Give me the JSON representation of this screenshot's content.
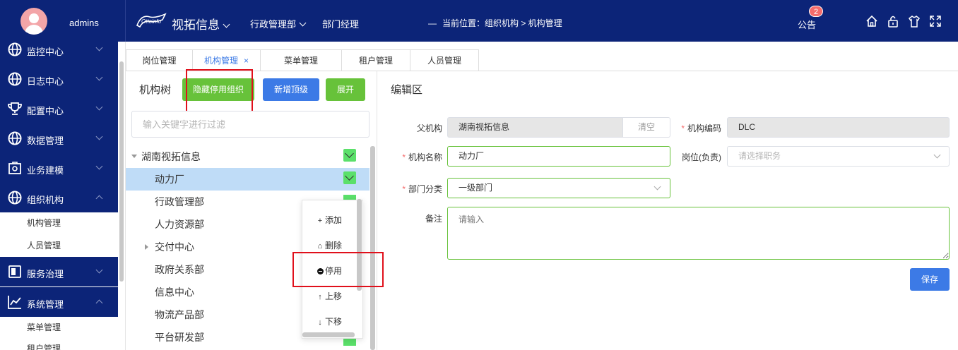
{
  "header": {
    "username": "admins",
    "brand": "视拓信息",
    "nav": [
      "行政管理部",
      "部门经理"
    ],
    "breadcrumb": "当前位置：组织机构 > 机构管理",
    "notice_label": "公告",
    "notice_count": "2"
  },
  "sidebar": {
    "items": [
      {
        "label": "监控中心",
        "icon": "globe-icon",
        "expanded": false
      },
      {
        "label": "日志中心",
        "icon": "globe-icon",
        "expanded": false
      },
      {
        "label": "配置中心",
        "icon": "trophy-icon",
        "expanded": false
      },
      {
        "label": "数据管理",
        "icon": "globe-icon",
        "expanded": false
      },
      {
        "label": "业务建模",
        "icon": "briefcase-gear-icon",
        "expanded": false
      },
      {
        "label": "组织机构",
        "icon": "globe-icon",
        "expanded": true,
        "children": [
          "机构管理",
          "人员管理"
        ]
      },
      {
        "label": "服务治理",
        "icon": "book-icon",
        "expanded": false
      },
      {
        "label": "系统管理",
        "icon": "chart-icon",
        "expanded": true,
        "children": [
          "菜单管理",
          "租户管理"
        ]
      }
    ]
  },
  "tabs": [
    {
      "label": "岗位管理",
      "active": false
    },
    {
      "label": "机构管理",
      "active": true,
      "close": "×"
    },
    {
      "label": "菜单管理",
      "active": false
    },
    {
      "label": "租户管理",
      "active": false
    },
    {
      "label": "人员管理",
      "active": false
    }
  ],
  "tree": {
    "title": "机构树",
    "buttons": {
      "hide_disabled": "隐藏停用组织",
      "add_top": "新增顶级",
      "expand": "展开"
    },
    "filter_placeholder": "输入关键字进行过滤",
    "nodes": [
      "湖南视拓信息",
      "动力厂",
      "行政管理部",
      "人力资源部",
      "交付中心",
      "政府关系部",
      "信息中心",
      "物流产品部",
      "平台研发部"
    ]
  },
  "context_menu": [
    {
      "label": "添加",
      "icon": "plus-icon"
    },
    {
      "label": "删除",
      "icon": "trash-icon"
    },
    {
      "label": "停用",
      "icon": "minus-circle-icon"
    },
    {
      "label": "上移",
      "icon": "arrow-up-icon"
    },
    {
      "label": "下移",
      "icon": "arrow-down-icon"
    }
  ],
  "editor": {
    "title": "编辑区",
    "parent_label": "父机构",
    "parent_value": "湖南视拓信息",
    "clear_label": "清空",
    "code_label": "机构编码",
    "code_value": "DLC",
    "name_label": "机构名称",
    "name_value": "动力厂",
    "post_label": "岗位(负责)",
    "post_placeholder": "请选择职务",
    "category_label": "部门分类",
    "category_value": "一级部门",
    "remark_label": "备注",
    "remark_placeholder": "请输入",
    "save_label": "保存"
  },
  "colors": {
    "nav_bg": "#0c2478",
    "green": "#67c23a",
    "blue": "#3c7ae6",
    "highlight": "#e0101b",
    "selected_row": "#bfdcf7"
  }
}
